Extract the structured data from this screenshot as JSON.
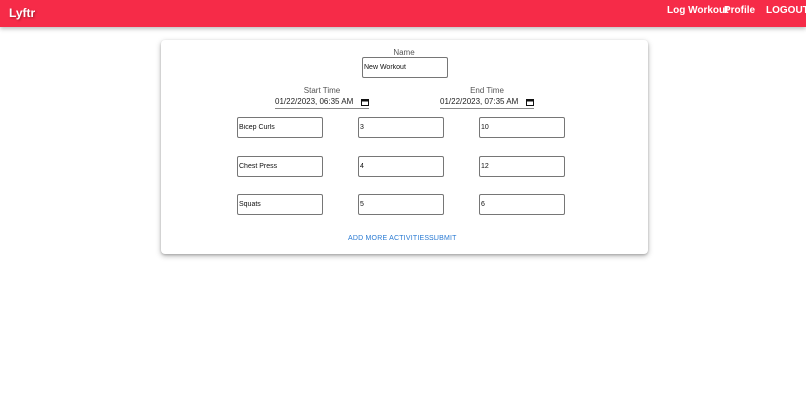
{
  "header": {
    "brand": "Lyftr",
    "nav": {
      "log_workout": "Log Workout",
      "profile": "Profile",
      "logout": "LOGOUT"
    }
  },
  "form": {
    "name_label": "Name",
    "name_value": "New Workout",
    "start_label": "Start Time",
    "start_value": "01/22/2023, 06:35 AM",
    "end_label": "End Time",
    "end_value": "01/22/2023, 07:35 AM",
    "activities": [
      {
        "name": "Bicep Curls",
        "sets": "3",
        "reps": "10"
      },
      {
        "name": "Chest Press",
        "sets": "4",
        "reps": "12"
      },
      {
        "name": "Squats",
        "sets": "5",
        "reps": "6"
      }
    ],
    "add_more_label": "ADD MORE ACTIVITIES...",
    "submit_label": "SUBMIT"
  },
  "colors": {
    "appbar": "#f62b48",
    "link": "#2b7bd3"
  },
  "icons": {
    "date_picker": "calendar-icon"
  }
}
